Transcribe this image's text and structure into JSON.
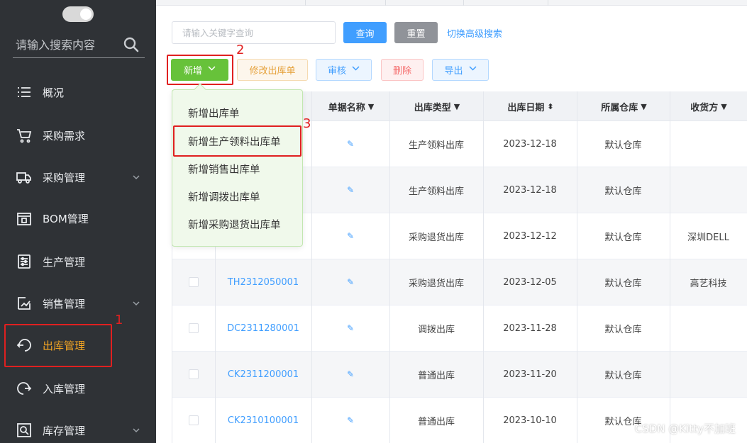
{
  "sidebar": {
    "search_placeholder": "请输入搜索内容",
    "items": [
      {
        "label": "概况",
        "icon": "list-icon",
        "has_chevron": false
      },
      {
        "label": "采购需求",
        "icon": "cart-icon",
        "has_chevron": false
      },
      {
        "label": "采购管理",
        "icon": "truck-icon",
        "has_chevron": true
      },
      {
        "label": "BOM管理",
        "icon": "bom-icon",
        "has_chevron": false
      },
      {
        "label": "生产管理",
        "icon": "sliders-icon",
        "has_chevron": false
      },
      {
        "label": "销售管理",
        "icon": "sales-icon",
        "has_chevron": true
      },
      {
        "label": "出库管理",
        "icon": "outbound-icon",
        "has_chevron": false,
        "active": true
      },
      {
        "label": "入库管理",
        "icon": "inbound-icon",
        "has_chevron": false
      },
      {
        "label": "库存管理",
        "icon": "inventory-icon",
        "has_chevron": true
      }
    ]
  },
  "query": {
    "keyword_placeholder": "请输入关键字查询",
    "search_label": "查询",
    "reset_label": "重置",
    "advanced_label": "切换高级搜索"
  },
  "toolbar": {
    "new_label": "新增",
    "edit_label": "修改出库单",
    "audit_label": "审核",
    "delete_label": "删除",
    "export_label": "导出"
  },
  "dropdown": {
    "items": [
      "新增出库单",
      "新增生产领料出库单",
      "新增销售出库单",
      "新增调拨出库单",
      "新增采购退货出库单"
    ]
  },
  "table": {
    "headers": [
      "单据名称",
      "出库类型",
      "出库日期",
      "所属仓库",
      "收货方"
    ],
    "rows": [
      {
        "code": "",
        "type": "生产领料出库",
        "date": "2023-12-18",
        "warehouse": "默认仓库",
        "receiver": ""
      },
      {
        "code": "",
        "type": "生产领料出库",
        "date": "2023-12-18",
        "warehouse": "默认仓库",
        "receiver": ""
      },
      {
        "code": "",
        "type": "采购退货出库",
        "date": "2023-12-12",
        "warehouse": "默认仓库",
        "receiver": "深圳DELL"
      },
      {
        "code": "TH2312050001",
        "type": "采购退货出库",
        "date": "2023-12-05",
        "warehouse": "默认仓库",
        "receiver": "高艺科技"
      },
      {
        "code": "DC2311280001",
        "type": "调拨出库",
        "date": "2023-11-28",
        "warehouse": "默认仓库",
        "receiver": ""
      },
      {
        "code": "CK2311200001",
        "type": "普通出库",
        "date": "2023-11-20",
        "warehouse": "默认仓库",
        "receiver": ""
      },
      {
        "code": "CK2310100001",
        "type": "普通出库",
        "date": "2023-10-10",
        "warehouse": "默认仓库",
        "receiver": ""
      }
    ]
  },
  "annotations": {
    "n1": "1",
    "n2": "2",
    "n3": "3",
    "color": "#e02020"
  },
  "watermark": "CSDN @Kitty不加班",
  "colors": {
    "sidebar_bg": "#2f3236",
    "active": "#f5a623",
    "primary": "#409eff",
    "success": "#67c23a"
  }
}
